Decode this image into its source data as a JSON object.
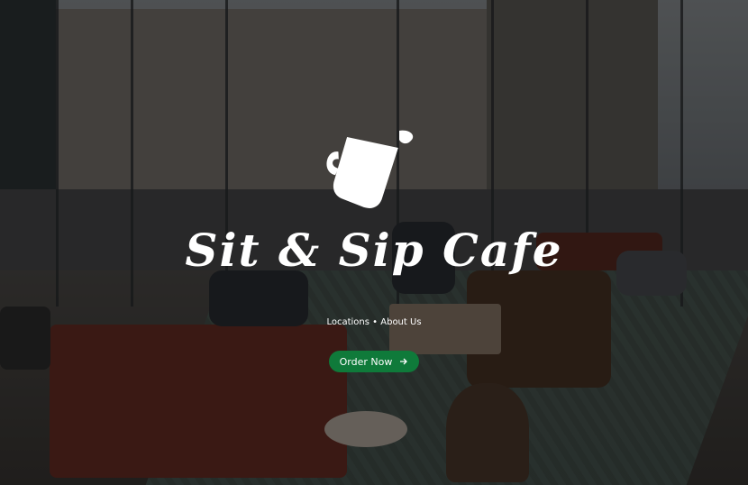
{
  "brand": {
    "name": "Sit & Sip Cafe",
    "logo_icon": "mug-icon"
  },
  "nav": {
    "locations": "Locations",
    "separator": "•",
    "about": "About Us"
  },
  "cta": {
    "order_label": "Order Now",
    "arrow_icon": "arrow-right-icon",
    "color": "#0f7a3a"
  },
  "background": {
    "overlay_color": "#000000"
  }
}
